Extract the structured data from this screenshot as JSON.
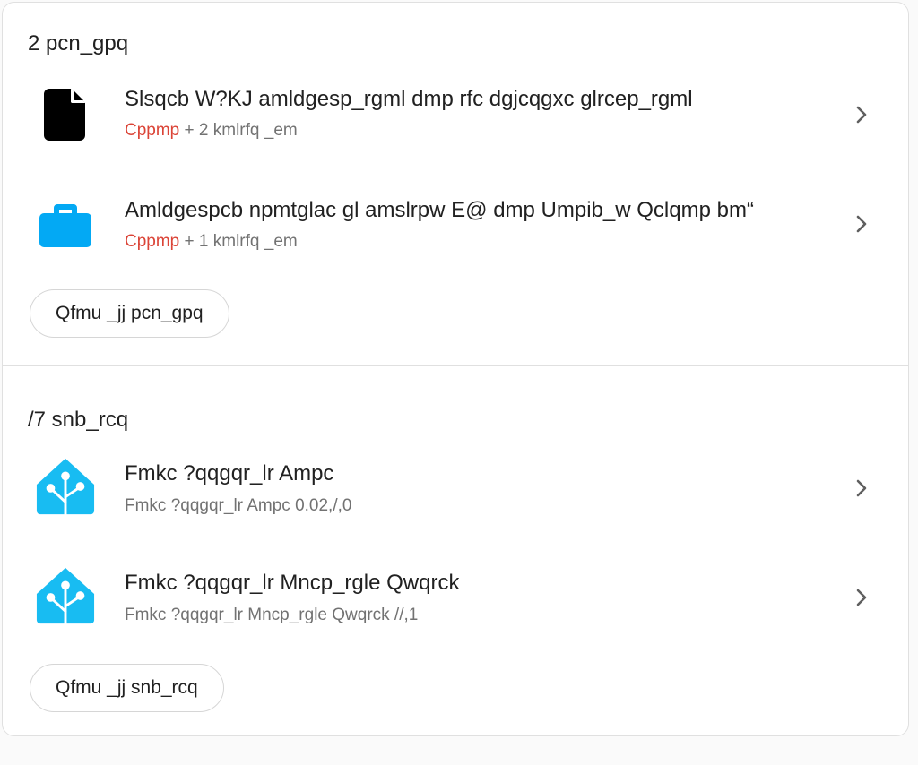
{
  "colors": {
    "accent": "#03a9f4",
    "status": "#db4437",
    "secondary": "#727272",
    "ha_blue": "#18bcf2"
  },
  "repairs": {
    "title": "2 pcn_gpq",
    "items": [
      {
        "title": "Slsqcb W?KJ amldgesp_rgml dmp rfc dgjcqgxc glrcep_rgml",
        "status": "Cppmp",
        "rest": " + 2 kmlrfq _em",
        "icon": "file-icon"
      },
      {
        "title": "Amldgespcb npmtglac gl amslrpw E@ dmp Umpib_w Qclqmp bm“",
        "status": "Cppmp",
        "rest": " + 1 kmlrfq _em",
        "icon": "briefcase-icon"
      }
    ],
    "button_label": "Qfmu _jj pcn_gpq"
  },
  "updates": {
    "title": "/7 snb_rcq",
    "items": [
      {
        "title": "Fmkc ?qqgqr_lr Ampc",
        "sub": "Fmkc ?qqgqr_lr Ampc 0.02,/,0",
        "icon": "home-assistant-icon"
      },
      {
        "title": "Fmkc ?qqgqr_lr Mncp_rgle Qwqrck",
        "sub": "Fmkc ?qqgqr_lr Mncp_rgle Qwqrck //,1",
        "icon": "home-assistant-icon"
      }
    ],
    "button_label": "Qfmu _jj snb_rcq"
  }
}
